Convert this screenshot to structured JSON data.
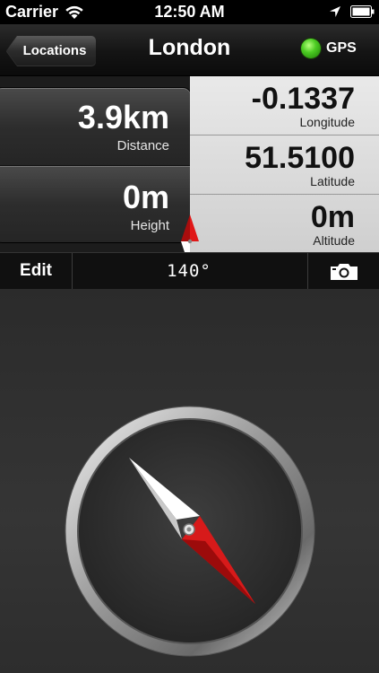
{
  "status_bar": {
    "carrier": "Carrier",
    "time": "12:50 AM",
    "icons": [
      "wifi-icon",
      "location-arrow-icon",
      "battery-icon"
    ]
  },
  "nav": {
    "back_label": "Locations",
    "title": "London",
    "gps_label": "GPS",
    "gps_status_color": "#4ccc23"
  },
  "readouts": {
    "distance": {
      "value": "3.9km",
      "label": "Distance"
    },
    "height": {
      "value": "0m",
      "label": "Height"
    },
    "longitude": {
      "value": "-0.1337",
      "label": "Longitude"
    },
    "latitude": {
      "value": "51.5100",
      "label": "Latitude"
    },
    "altitude": {
      "value": "0m",
      "label": "Altitude"
    }
  },
  "toolbar": {
    "edit_label": "Edit",
    "heading": "140°",
    "camera_icon": "camera-icon"
  },
  "compass": {
    "needle_north_color": "#d71a1a",
    "needle_south_color": "#ffffff"
  }
}
